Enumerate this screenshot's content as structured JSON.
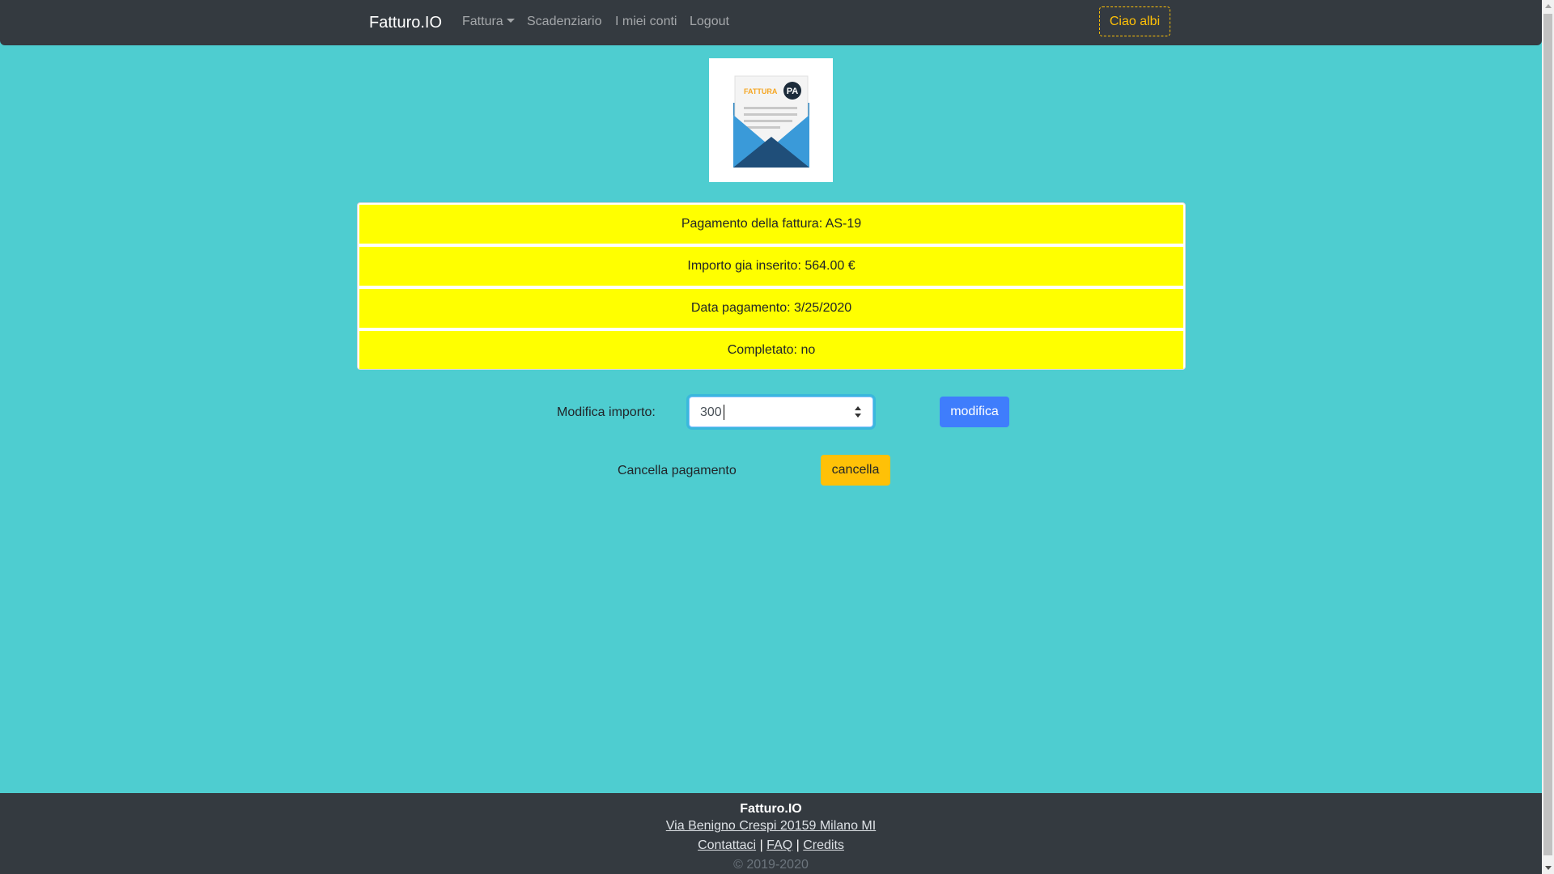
{
  "navbar": {
    "brand": "Fatturo.IO",
    "items": [
      {
        "label": "Fattura"
      },
      {
        "label": "Scadenziario"
      },
      {
        "label": "I miei conti"
      },
      {
        "label": "Logout"
      }
    ],
    "user_button": "Ciao albi"
  },
  "logo": {
    "text_fattura": "FATTURA",
    "text_pa": "PA"
  },
  "payment_info": {
    "items": [
      {
        "text": "Pagamento della fattura: AS-19"
      },
      {
        "text": "Importo gia inserito: 564.00 €"
      },
      {
        "text": "Data pagamento: 3/25/2020"
      },
      {
        "text": "Completato: no"
      }
    ]
  },
  "form": {
    "modify_label": "Modifica importo:",
    "amount_value": "300",
    "modify_button": "modifica",
    "cancel_label": "Cancella pagamento",
    "cancel_button": "cancella"
  },
  "footer": {
    "title": "Fatturo.IO",
    "address": "Via Benigno Crespi 20159 Milano MI",
    "links": [
      {
        "label": "Contattaci"
      },
      {
        "label": "FAQ"
      },
      {
        "label": "Credits"
      }
    ],
    "separator": "|",
    "copyright": "© 2019-2020"
  },
  "colors": {
    "page_bg": "#4ecdd0",
    "navbar_bg": "#343a40",
    "highlight": "#ffff00",
    "primary": "#3f7dfc",
    "warning": "#ffc107"
  }
}
